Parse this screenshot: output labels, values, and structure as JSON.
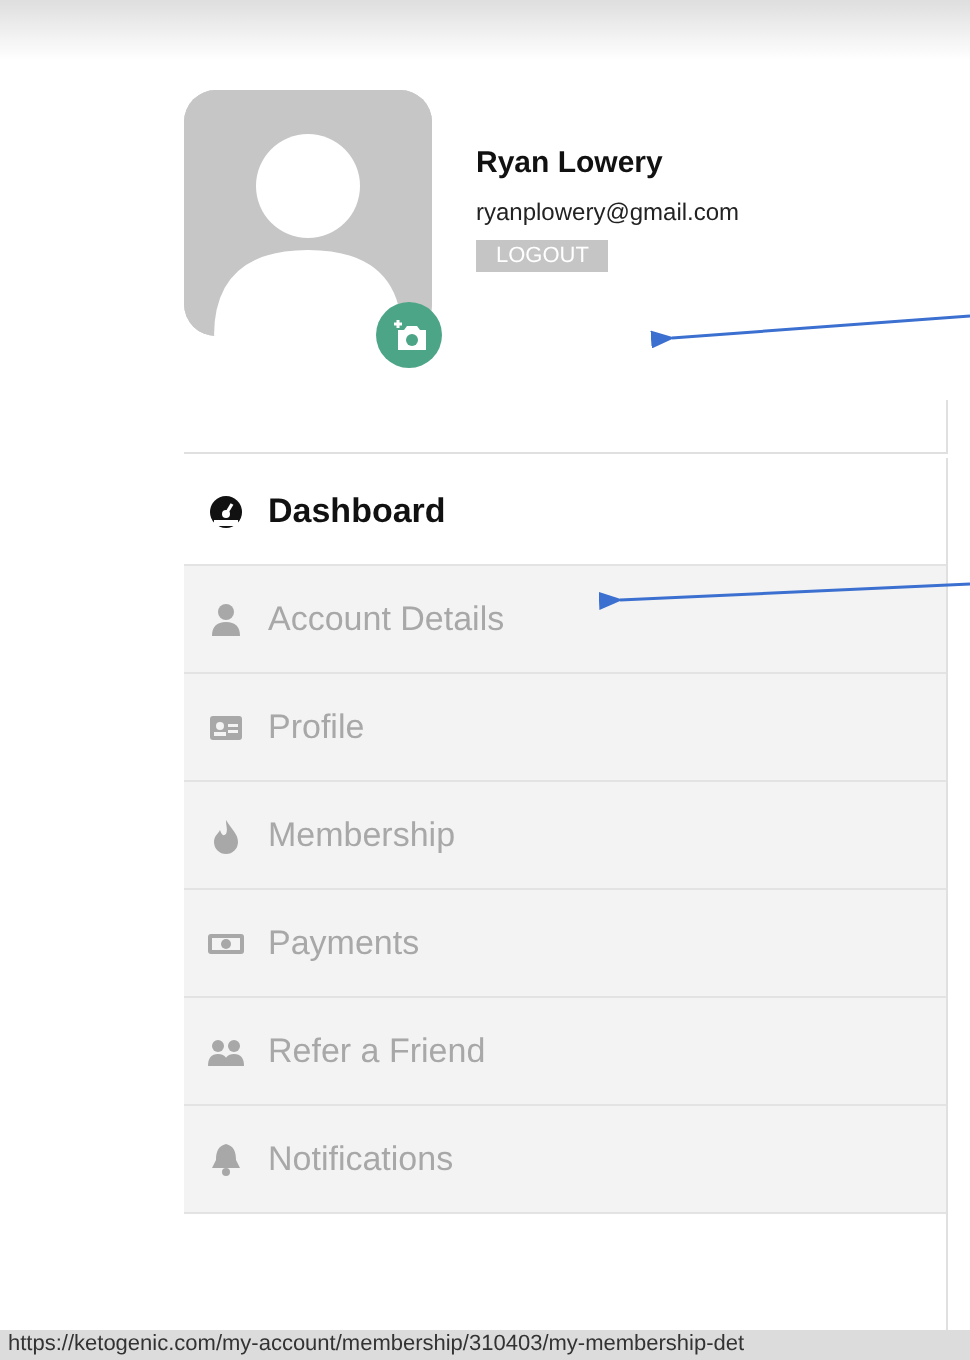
{
  "user": {
    "name": "Ryan Lowery",
    "email": "ryanplowery@gmail.com",
    "logout": "LOGOUT"
  },
  "menu": [
    {
      "label": "Dashboard",
      "kind": "gauge",
      "selected": true
    },
    {
      "label": "Account Details",
      "kind": "person",
      "selected": false
    },
    {
      "label": "Profile",
      "kind": "card",
      "selected": false
    },
    {
      "label": "Membership",
      "kind": "flame",
      "selected": false
    },
    {
      "label": "Payments",
      "kind": "money",
      "selected": false
    },
    {
      "label": "Refer a Friend",
      "kind": "people",
      "selected": false
    },
    {
      "label": "Notifications",
      "kind": "bell",
      "selected": false
    }
  ],
  "status_bar": {
    "url": "https://ketogenic.com/my-account/membership/310403/my-membership-det"
  }
}
